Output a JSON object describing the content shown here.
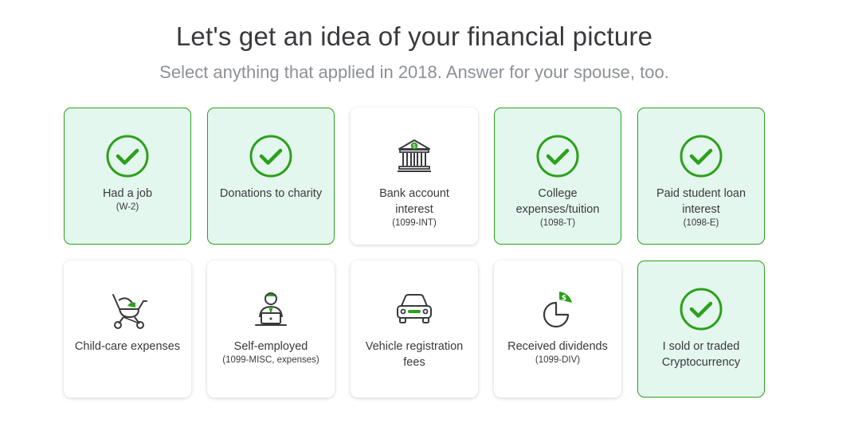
{
  "header": {
    "title": "Let's get an idea of your financial picture",
    "subtitle": "Select anything that applied in 2018. Answer for your spouse, too."
  },
  "colors": {
    "accent_green": "#2ca01c",
    "selected_bg": "#e4f7ee",
    "text": "#393a3d",
    "subtitle": "#8d9096"
  },
  "tiles": [
    {
      "label": "Had a job",
      "sub": "(W-2)",
      "selected": true,
      "icon": "checkmark-icon"
    },
    {
      "label": "Donations to charity",
      "sub": "",
      "selected": true,
      "icon": "checkmark-icon"
    },
    {
      "label": "Bank account interest",
      "sub": "(1099-INT)",
      "selected": false,
      "icon": "bank-icon"
    },
    {
      "label": "College expenses/tuition",
      "sub": "(1098-T)",
      "selected": true,
      "icon": "checkmark-icon"
    },
    {
      "label": "Paid student loan interest",
      "sub": "(1098-E)",
      "selected": true,
      "icon": "checkmark-icon"
    },
    {
      "label": "Child-care expenses",
      "sub": "",
      "selected": false,
      "icon": "stroller-icon"
    },
    {
      "label": "Self-employed",
      "sub": "(1099-MISC, expenses)",
      "selected": false,
      "icon": "freelancer-laptop-icon"
    },
    {
      "label": "Vehicle registration fees",
      "sub": "",
      "selected": false,
      "icon": "car-icon"
    },
    {
      "label": "Received dividends",
      "sub": "(1099-DIV)",
      "selected": false,
      "icon": "pie-dividend-icon"
    },
    {
      "label": "I sold or traded Cryptocurrency",
      "sub": "",
      "selected": true,
      "icon": "checkmark-icon"
    }
  ]
}
